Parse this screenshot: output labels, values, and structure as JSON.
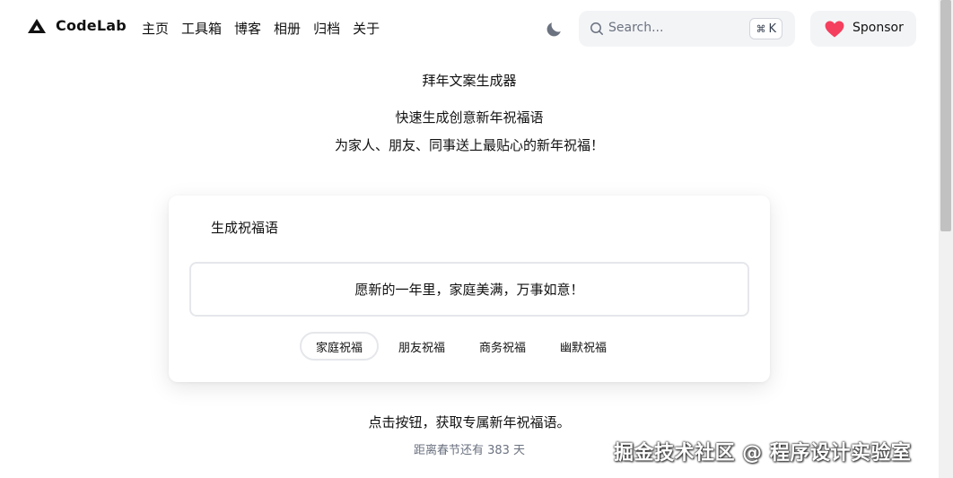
{
  "header": {
    "brand": "CodeLab",
    "nav": [
      "主页",
      "工具箱",
      "博客",
      "相册",
      "归档",
      "关于"
    ],
    "search": {
      "placeholder": "Search...",
      "shortcut_symbol": "⌘",
      "shortcut_key": "K"
    },
    "sponsor_label": "Sponsor"
  },
  "hero": {
    "title": "拜年文案生成器",
    "subtitle_line1": "快速生成创意新年祝福语",
    "subtitle_line2": "为家人、朋友、同事送上最贴心的新年祝福！"
  },
  "card": {
    "title": "生成祝福语",
    "greeting": "愿新的一年里，家庭美满，万事如意！",
    "categories": [
      "家庭祝福",
      "朋友祝福",
      "商务祝福",
      "幽默祝福"
    ],
    "active_category": "家庭祝福"
  },
  "footer": {
    "hint": "点击按钮，获取专属新年祝福语。",
    "countdown": "距离春节还有 383 天"
  },
  "watermark": "掘金技术社区 @ 程序设计实验室",
  "colors": {
    "accent_heart": "#f43f5e",
    "moon": "#6b7280",
    "search_bg": "#f3f4f6"
  },
  "icons": {
    "logo": "triangle-logo-icon",
    "theme": "moon-icon",
    "search": "search-icon",
    "sponsor": "heart-icon"
  }
}
